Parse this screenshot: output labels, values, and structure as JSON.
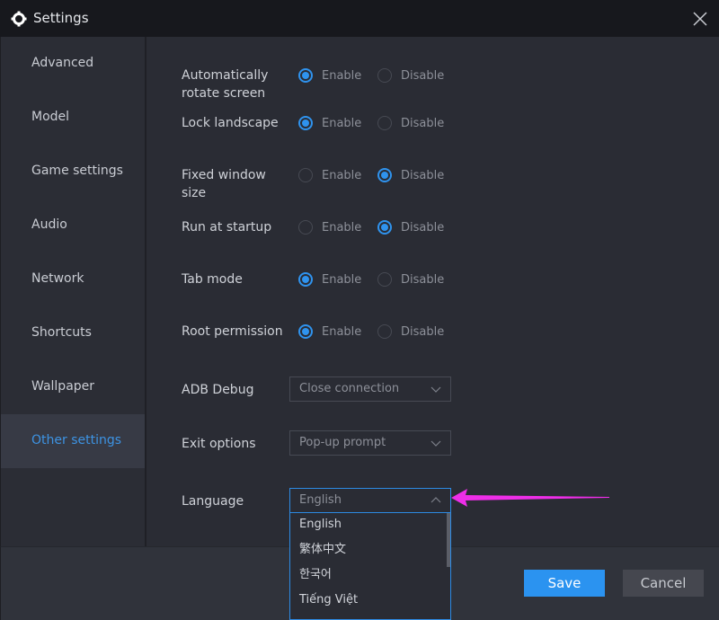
{
  "window": {
    "title": "Settings",
    "title_icon": "gear-icon",
    "close_icon": "close-icon"
  },
  "colors": {
    "accent": "#2b93f0",
    "annotation_arrow": "#ee2ee8"
  },
  "sidebar": {
    "items": [
      {
        "label": "Advanced"
      },
      {
        "label": "Model"
      },
      {
        "label": "Game settings"
      },
      {
        "label": "Audio"
      },
      {
        "label": "Network"
      },
      {
        "label": "Shortcuts"
      },
      {
        "label": "Wallpaper"
      },
      {
        "label": "Other settings",
        "active": true
      }
    ]
  },
  "settings": {
    "enable_label": "Enable",
    "disable_label": "Disable",
    "rows": [
      {
        "label": "Automatically rotate screen",
        "value": "Enable"
      },
      {
        "label": "Lock landscape",
        "value": "Enable"
      },
      {
        "label": "Fixed window size",
        "value": "Disable"
      },
      {
        "label": "Run at startup",
        "value": "Disable"
      },
      {
        "label": "Tab mode",
        "value": "Enable"
      },
      {
        "label": "Root permission",
        "value": "Enable"
      }
    ],
    "adb_debug": {
      "label": "ADB Debug",
      "value": "Close connection"
    },
    "exit_options": {
      "label": "Exit options",
      "value": "Pop-up prompt"
    },
    "language": {
      "label": "Language",
      "value": "English",
      "options": [
        "English",
        "繁体中文",
        "한국어",
        "Tiếng Việt"
      ]
    }
  },
  "footer": {
    "save_label": "Save",
    "cancel_label": "Cancel"
  }
}
